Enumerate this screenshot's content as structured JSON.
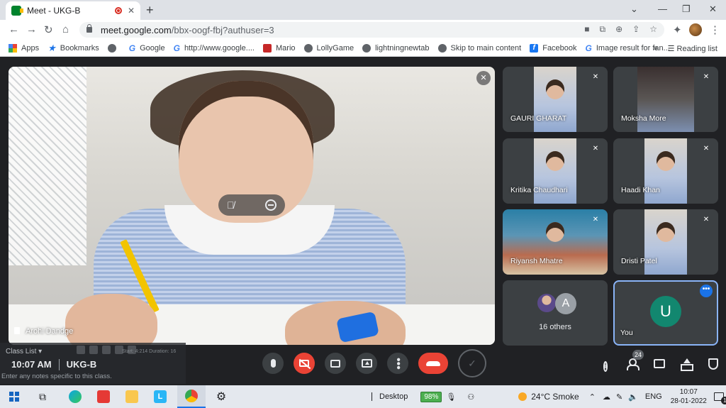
{
  "browser": {
    "tab_title": "Meet - UKG-B",
    "url_host": "meet.google.com",
    "url_path": "/bbx-oogf-fbj?authuser=3"
  },
  "bookmarks": [
    {
      "label": "Apps",
      "icon": "apps-icon"
    },
    {
      "label": "Bookmarks",
      "icon": "star-icon"
    },
    {
      "label": "",
      "icon": "globe-icon"
    },
    {
      "label": "Google",
      "icon": "google-icon"
    },
    {
      "label": "http://www.google....",
      "icon": "google-icon"
    },
    {
      "label": "Mario",
      "icon": "mario-icon"
    },
    {
      "label": "LollyGame",
      "icon": "globe-icon"
    },
    {
      "label": "lightningnewtab",
      "icon": "globe-icon"
    },
    {
      "label": "Skip to main content",
      "icon": "globe-icon"
    },
    {
      "label": "Facebook",
      "icon": "facebook-icon"
    },
    {
      "label": "Image result for fan...",
      "icon": "google-icon"
    }
  ],
  "bookmarks_more": "»",
  "reading_list": "Reading list",
  "main_participant": {
    "name": "Arohi Dandge"
  },
  "participants": [
    {
      "name": "GAURI GHARAT"
    },
    {
      "name": "Moksha More"
    },
    {
      "name": "Kritika Chaudhari"
    },
    {
      "name": "Haadi Khan"
    },
    {
      "name": "Riyansh Mhatre"
    },
    {
      "name": "Dristi Patel"
    }
  ],
  "others": {
    "letter": "A",
    "label": "16 others"
  },
  "self": {
    "letter": "U",
    "label": "You"
  },
  "notes": {
    "title": "Class List",
    "meta": "Start: 4:214 Duration: 16",
    "hint": "Enter any notes specific to this class."
  },
  "meeting": {
    "time": "10:07 AM",
    "code": "UKG-B"
  },
  "people_count": "24",
  "taskbar": {
    "desktop": "Desktop",
    "battery": "98%",
    "weather": "24°C  Smoke",
    "lang": "ENG",
    "time": "10:07",
    "date": "28-01-2022",
    "notifications": "1"
  },
  "colors": {
    "accent": "#1a73e8",
    "danger": "#ea4335",
    "avatar_you": "#12876f",
    "background": "#202124"
  }
}
